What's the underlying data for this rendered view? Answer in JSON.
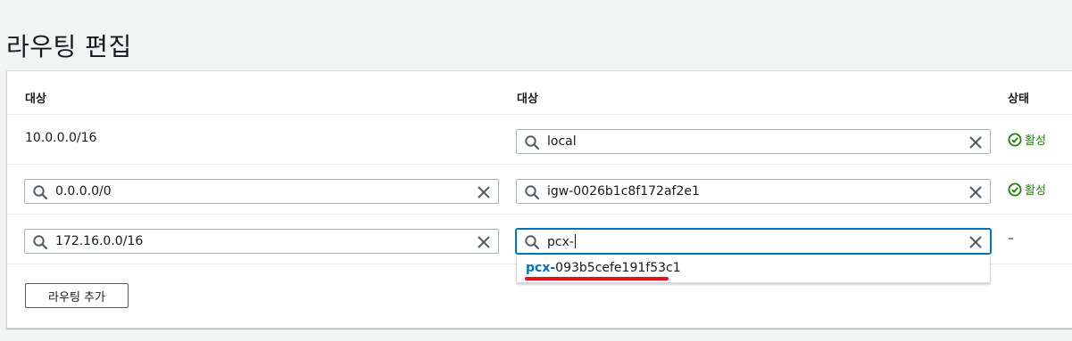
{
  "page": {
    "title": "라우팅 편집"
  },
  "table": {
    "headers": {
      "destination": "대상",
      "target": "대상",
      "status": "상태"
    },
    "rows": [
      {
        "destination": "10.0.0.0/16",
        "target": "local",
        "status": "활성"
      },
      {
        "destination": "0.0.0.0/0",
        "target": "igw-0026b1c8f172af2e1",
        "status": "활성"
      },
      {
        "destination": "172.16.0.0/16",
        "target": "pcx-",
        "status": "–"
      }
    ]
  },
  "suggestion": {
    "match": "pcx-",
    "rest": "093b5cefe191f53c1"
  },
  "buttons": {
    "add_route": "라우팅 추가"
  },
  "colors": {
    "status_active": "#1d8102",
    "focus_border": "#0073bb",
    "highlight_underline": "#e0141e",
    "suggestion_match": "#0073bb"
  },
  "icons": {
    "search": "search-icon",
    "clear": "close-icon",
    "status_active": "check-circle-icon"
  }
}
